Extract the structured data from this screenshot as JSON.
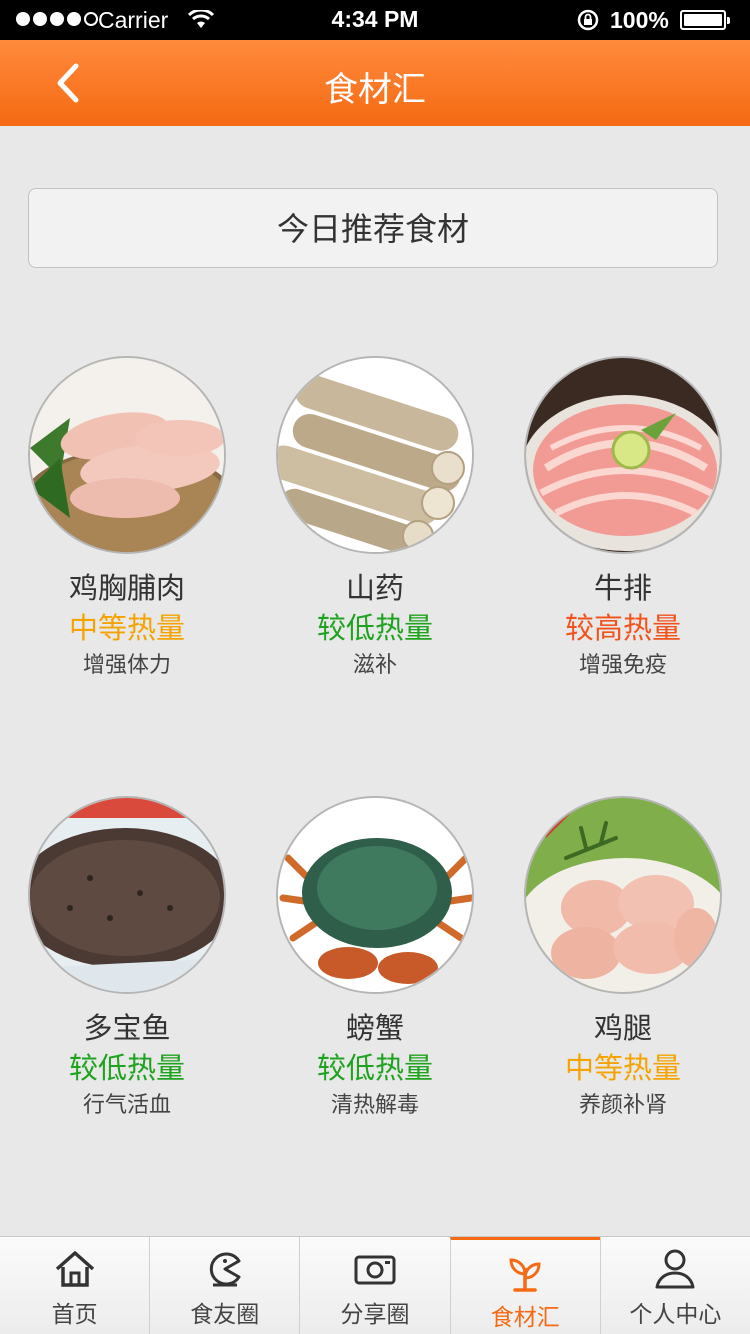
{
  "status_bar": {
    "carrier": "Carrier",
    "time": "4:34 PM",
    "battery": "100%"
  },
  "nav": {
    "title": "食材汇",
    "back_icon": "chevron-left-icon"
  },
  "recommend_button": "今日推荐食材",
  "colors": {
    "accent": "#f56a12",
    "calorie_mid": "#f5a300",
    "calorie_low": "#1fa31f",
    "calorie_high": "#f2531c"
  },
  "foods": [
    {
      "name": "鸡胸脯肉",
      "calorie": "中等热量",
      "calorie_level": "mid",
      "effect": "增强体力"
    },
    {
      "name": "山药",
      "calorie": "较低热量",
      "calorie_level": "low",
      "effect": "滋补"
    },
    {
      "name": "牛排",
      "calorie": "较高热量",
      "calorie_level": "high",
      "effect": "增强免疫"
    },
    {
      "name": "多宝鱼",
      "calorie": "较低热量",
      "calorie_level": "low",
      "effect": "行气活血"
    },
    {
      "name": "螃蟹",
      "calorie": "较低热量",
      "calorie_level": "low",
      "effect": "清热解毒"
    },
    {
      "name": "鸡腿",
      "calorie": "中等热量",
      "calorie_level": "mid",
      "effect": "养颜补肾"
    }
  ],
  "tabs": [
    {
      "label": "首页",
      "icon": "home-icon",
      "active": false
    },
    {
      "label": "食友圈",
      "icon": "pacman-icon",
      "active": false
    },
    {
      "label": "分享圈",
      "icon": "camera-icon",
      "active": false
    },
    {
      "label": "食材汇",
      "icon": "sprout-icon",
      "active": true
    },
    {
      "label": "个人中心",
      "icon": "user-icon",
      "active": false
    }
  ]
}
